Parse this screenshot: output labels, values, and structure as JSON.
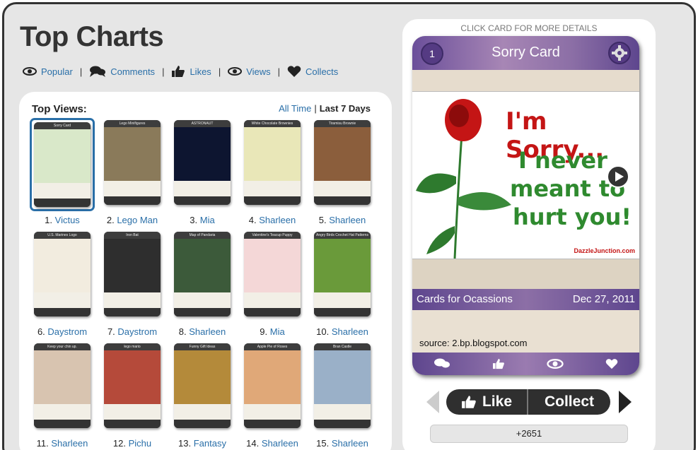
{
  "page": {
    "title": "Top Charts"
  },
  "nav": [
    {
      "label": "Popular",
      "icon": "eye-icon"
    },
    {
      "label": "Comments",
      "icon": "comments-icon"
    },
    {
      "label": "Likes",
      "icon": "thumbs-up-icon"
    },
    {
      "label": "Views",
      "icon": "eye-icon"
    },
    {
      "label": "Collects",
      "icon": "heart-icon"
    }
  ],
  "panel": {
    "heading": "Top Views:",
    "filter_all": "All Time",
    "filter_sep": "|",
    "filter_active": "Last 7 Days"
  },
  "cards": [
    {
      "rank": "1.",
      "user": "Victus",
      "title": "Sorry Card",
      "color": "#d9e8c9"
    },
    {
      "rank": "2.",
      "user": "Lego Man",
      "title": "Lego Minifigures",
      "color": "#8a7a5a"
    },
    {
      "rank": "3.",
      "user": "Mia",
      "title": "ASTRONAUT",
      "color": "#0d1530"
    },
    {
      "rank": "4.",
      "user": "Sharleen",
      "title": "White Chocolate Brownies",
      "color": "#e9e7b8"
    },
    {
      "rank": "5.",
      "user": "Sharleen",
      "title": "Tiramisu Brownie",
      "color": "#8b5e3c"
    },
    {
      "rank": "6.",
      "user": "Daystrom",
      "title": "U.S. Marines Logo",
      "color": "#f2ecdf"
    },
    {
      "rank": "7.",
      "user": "Daystrom",
      "title": "Iron Bat",
      "color": "#2e2e2e"
    },
    {
      "rank": "8.",
      "user": "Sharleen",
      "title": "Map of Pandaria",
      "color": "#3c5a3a"
    },
    {
      "rank": "9.",
      "user": "Mia",
      "title": "Valentine's Teacup Puppy",
      "color": "#f4d7d7"
    },
    {
      "rank": "10.",
      "user": "Sharleen",
      "title": "Angry Birds Crochet Hat Patterns",
      "color": "#6a9a3a"
    },
    {
      "rank": "11.",
      "user": "Sharleen",
      "title": "Keep your chin up.",
      "color": "#d8c4b0"
    },
    {
      "rank": "12.",
      "user": "Pichu",
      "title": "lego mario",
      "color": "#b54a3a"
    },
    {
      "rank": "13.",
      "user": "Fantasy",
      "title": "Funny Gift Ideas",
      "color": "#b48a3a"
    },
    {
      "rank": "14.",
      "user": "Sharleen",
      "title": "Apple Pie of Roses",
      "color": "#e0a878"
    },
    {
      "rank": "15.",
      "user": "Sharleen",
      "title": "Bran Castle",
      "color": "#9ab0c8"
    }
  ],
  "detail": {
    "hint": "CLICK CARD FOR MORE DETAILS",
    "number": "1",
    "title": "Sorry Card",
    "img_line1": "I'm Sorry...",
    "img_line2": "I never",
    "img_line3": "meant to",
    "img_line4": "hurt you!",
    "watermark": "DazzleJunction.com",
    "category": "Cards for Ocassions",
    "date": "Dec 27, 2011",
    "source": "source: 2.bp.blogspot.com",
    "like_label": "Like",
    "collect_label": "Collect",
    "count": "+2651"
  }
}
